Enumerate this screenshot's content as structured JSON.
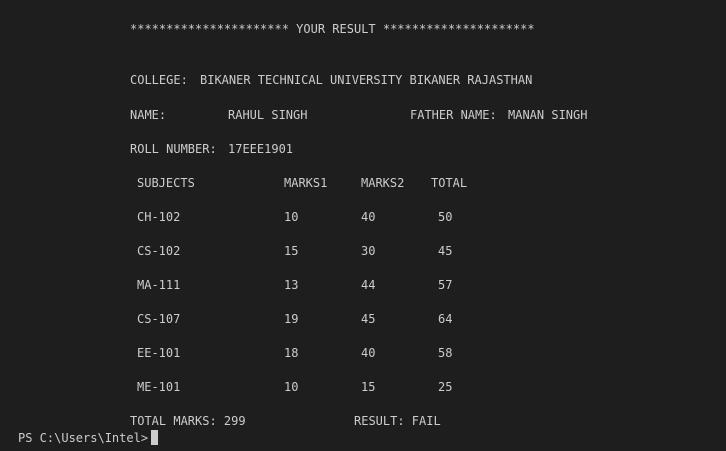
{
  "banner": "********************** YOUR RESULT *********************",
  "college": {
    "label": "COLLEGE:",
    "value": "BIKANER TECHNICAL UNIVERSITY BIKANER RAJASTHAN"
  },
  "student": {
    "name_label": "NAME:",
    "name_value": "RAHUL SINGH",
    "father_label": "FATHER NAME:",
    "father_value": "MANAN SINGH",
    "roll_label": "ROLL NUMBER:",
    "roll_value": "17EEE1901"
  },
  "table": {
    "headers": [
      "SUBJECTS",
      "MARKS1",
      "MARKS2",
      "TOTAL"
    ],
    "rows": [
      [
        "CH-102",
        "10",
        "40",
        "50"
      ],
      [
        "CS-102",
        "15",
        "30",
        "45"
      ],
      [
        "MA-111",
        "13",
        "44",
        "57"
      ],
      [
        "CS-107",
        "19",
        "45",
        "64"
      ],
      [
        "EE-101",
        "18",
        "40",
        "58"
      ],
      [
        "ME-101",
        "10",
        "15",
        "25"
      ]
    ]
  },
  "summary": {
    "total_marks": "TOTAL MARKS: 299",
    "result": "RESULT: FAIL"
  },
  "prompt": "PS C:\\Users\\Intel>"
}
